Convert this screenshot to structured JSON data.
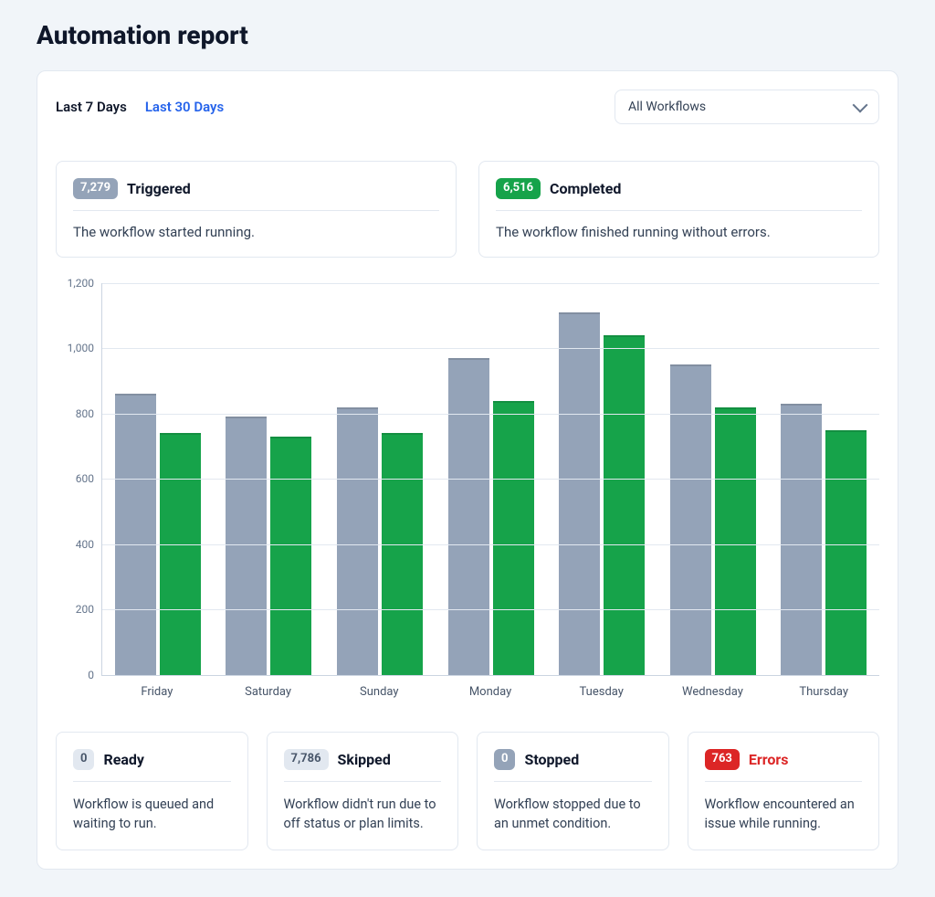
{
  "page_title": "Automation report",
  "tabs": {
    "last7": "Last 7 Days",
    "last30": "Last 30 Days"
  },
  "workflow_filter": {
    "selected": "All Workflows"
  },
  "colors": {
    "series0": "#94a3b8",
    "series1": "#16a34a"
  },
  "top_cards": [
    {
      "badge": "7,279",
      "badge_class": "badge-gray",
      "title": "Triggered",
      "desc": "The workflow started running."
    },
    {
      "badge": "6,516",
      "badge_class": "badge-green",
      "title": "Completed",
      "desc": "The workflow finished running without errors."
    }
  ],
  "bottom_cards": [
    {
      "badge": "0",
      "badge_class": "badge-light",
      "title": "Ready",
      "title_class": "",
      "desc": "Workflow is queued and waiting to run."
    },
    {
      "badge": "7,786",
      "badge_class": "badge-light",
      "title": "Skipped",
      "title_class": "",
      "desc": "Workflow didn't run due to off status or plan limits."
    },
    {
      "badge": "0",
      "badge_class": "badge-gray",
      "title": "Stopped",
      "title_class": "",
      "desc": "Workflow stopped due to an unmet condition."
    },
    {
      "badge": "763",
      "badge_class": "badge-red",
      "title": "Errors",
      "title_class": "red",
      "desc": "Workflow encountered an issue while running."
    }
  ],
  "chart_data": {
    "type": "bar",
    "title": "",
    "xlabel": "",
    "ylabel": "",
    "ylim": [
      0,
      1200
    ],
    "y_ticks": [
      0,
      200,
      400,
      600,
      800,
      1000,
      1200
    ],
    "y_tick_labels": [
      "0",
      "200",
      "400",
      "600",
      "800",
      "1,000",
      "1,200"
    ],
    "categories": [
      "Friday",
      "Saturday",
      "Sunday",
      "Monday",
      "Tuesday",
      "Wednesday",
      "Thursday"
    ],
    "series": [
      {
        "name": "Triggered",
        "color": "#94a3b8",
        "values": [
          860,
          790,
          820,
          970,
          1110,
          950,
          830
        ]
      },
      {
        "name": "Completed",
        "color": "#16a34a",
        "values": [
          740,
          730,
          740,
          840,
          1040,
          820,
          750
        ]
      }
    ]
  }
}
